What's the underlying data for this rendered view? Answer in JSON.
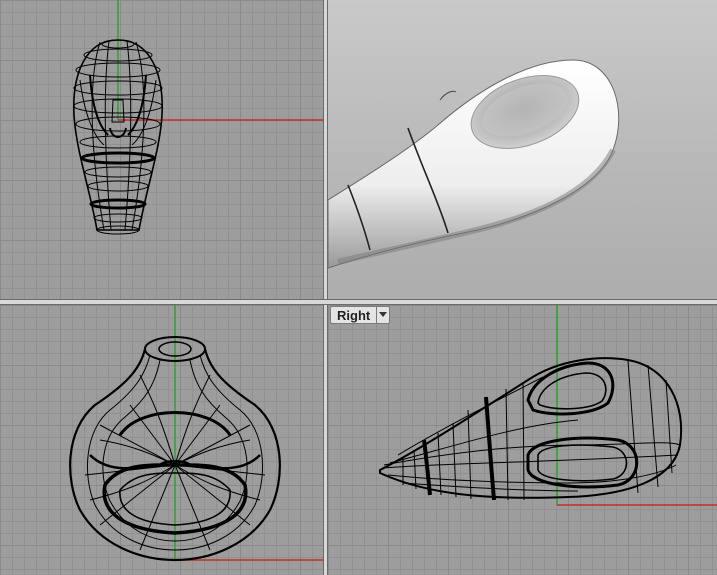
{
  "viewports": {
    "top_left": {
      "name": "top-viewport"
    },
    "top_right": {
      "name": "perspective-viewport"
    },
    "bottom_left": {
      "name": "front-viewport"
    },
    "bottom_right": {
      "name": "right-viewport",
      "tab_label": "Right",
      "tab_icon": "chevron-down-icon"
    }
  },
  "colors": {
    "grid_background": "#9d9d9d",
    "grid_line": "#8a8a8a",
    "x_axis": "#c0302a",
    "y_axis": "#2aa52a",
    "wire": "#000000",
    "shaded_body": "#f2f2f2"
  }
}
